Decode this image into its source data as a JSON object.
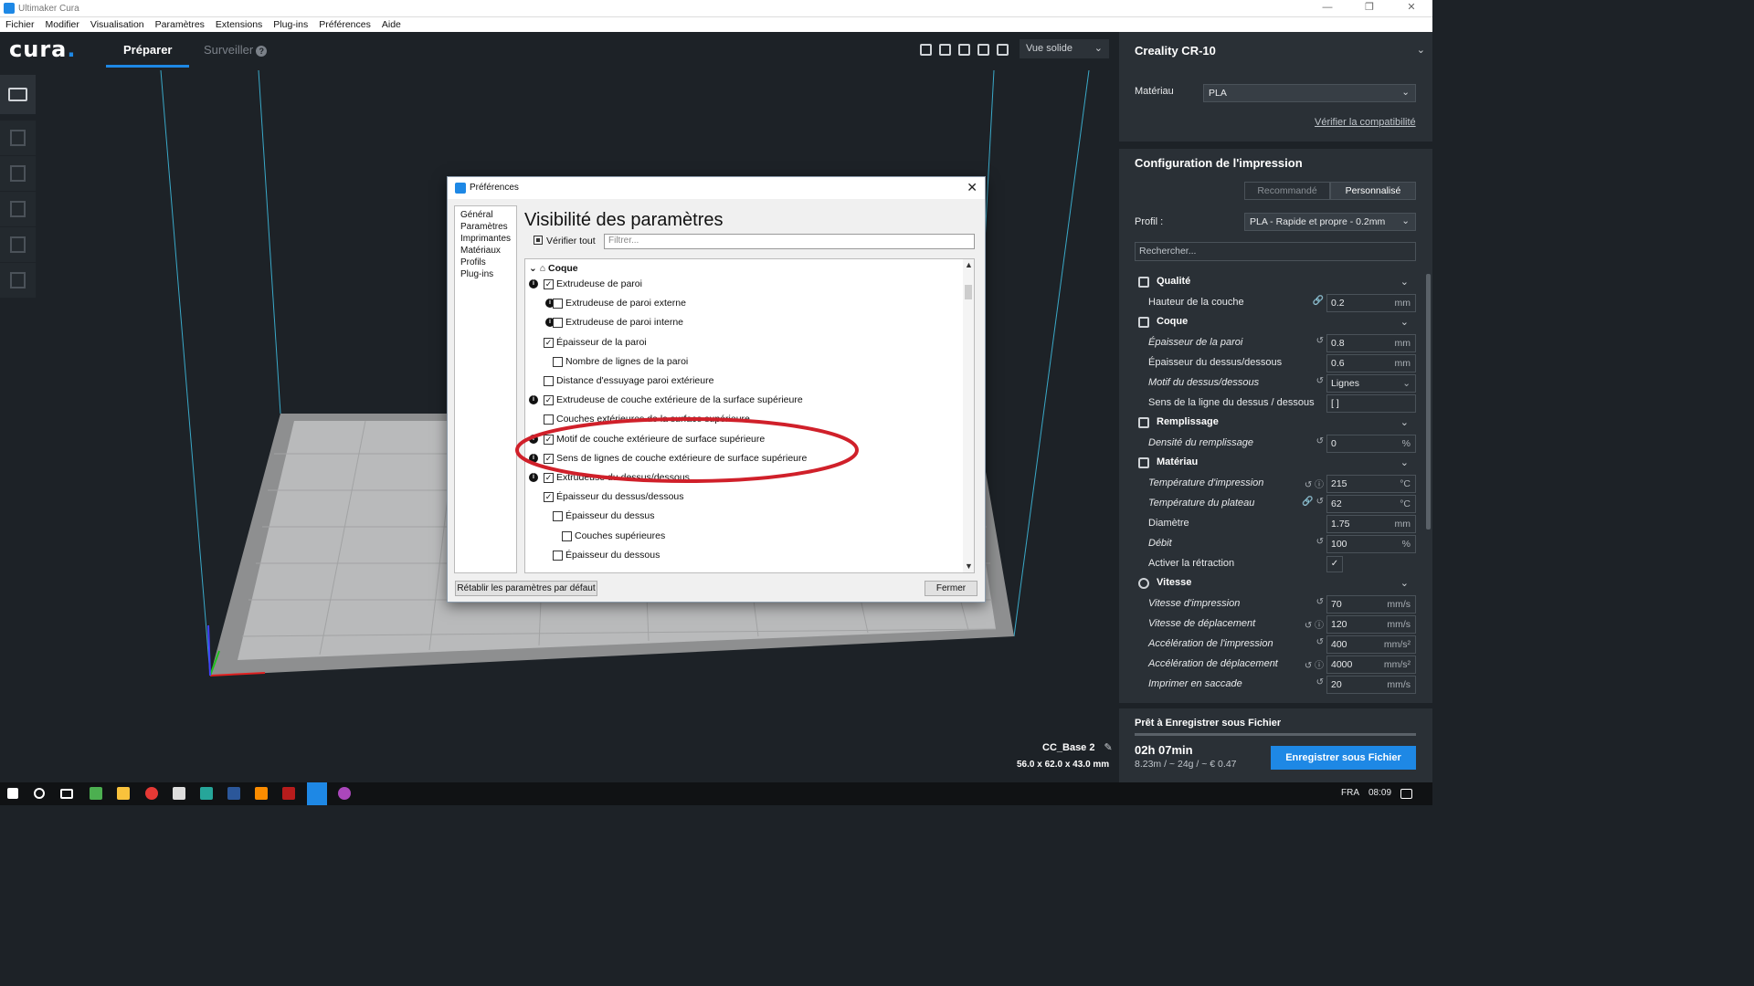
{
  "window": {
    "title": "Ultimaker Cura",
    "controls": [
      "—",
      "❐",
      "✕"
    ]
  },
  "menu": [
    "Fichier",
    "Modifier",
    "Visualisation",
    "Paramètres",
    "Extensions",
    "Plug-ins",
    "Préférences",
    "Aide"
  ],
  "header": {
    "logo": "cura",
    "logo_dot": ".",
    "tab_prepare": "Préparer",
    "tab_monitor": "Surveiller",
    "help_glyph": "?",
    "view_mode": "Vue solide"
  },
  "object": {
    "name": "CC_Base 2",
    "dimensions": "56.0 x 62.0 x 43.0 mm"
  },
  "sidebar": {
    "printer": "Creality CR-10",
    "material_label": "Matériau",
    "material_value": "PLA",
    "verify_link": "Vérifier la compatibilité",
    "config_title": "Configuration de l'impression",
    "mode_recommended": "Recommandé",
    "mode_custom": "Personnalisé",
    "profile_label": "Profil :",
    "profile_value": "PLA - Rapide et propre - 0.2mm",
    "search_placeholder": "Rechercher...",
    "categories": {
      "quality": "Qualité",
      "shell": "Coque",
      "infill": "Remplissage",
      "material": "Matériau",
      "speed": "Vitesse"
    },
    "settings": {
      "layer_height": {
        "label": "Hauteur de la couche",
        "value": "0.2",
        "unit": "mm"
      },
      "wall_thickness": {
        "label": "Épaisseur de la paroi",
        "value": "0.8",
        "unit": "mm"
      },
      "top_bottom_thickness": {
        "label": "Épaisseur du dessus/dessous",
        "value": "0.6",
        "unit": "mm"
      },
      "top_bottom_pattern": {
        "label": "Motif du dessus/dessous",
        "value": "Lignes"
      },
      "top_bottom_direction": {
        "label": "Sens de la ligne du dessus / dessous",
        "value": "[ ]"
      },
      "infill_density": {
        "label": "Densité du remplissage",
        "value": "0",
        "unit": "%"
      },
      "print_temp": {
        "label": "Température d'impression",
        "value": "215",
        "unit": "°C"
      },
      "bed_temp": {
        "label": "Température du plateau",
        "value": "62",
        "unit": "°C"
      },
      "diameter": {
        "label": "Diamètre",
        "value": "1.75",
        "unit": "mm"
      },
      "flow": {
        "label": "Débit",
        "value": "100",
        "unit": "%"
      },
      "retraction": {
        "label": "Activer la rétraction",
        "value": "✓"
      },
      "print_speed": {
        "label": "Vitesse d'impression",
        "value": "70",
        "unit": "mm/s"
      },
      "travel_speed": {
        "label": "Vitesse de déplacement",
        "value": "120",
        "unit": "mm/s"
      },
      "print_accel": {
        "label": "Accélération de l'impression",
        "value": "400",
        "unit": "mm/s²"
      },
      "travel_accel": {
        "label": "Accélération de déplacement",
        "value": "4000",
        "unit": "mm/s²"
      },
      "jerk": {
        "label": "Imprimer en saccade",
        "value": "20",
        "unit": "mm/s"
      }
    },
    "ready_title": "Prêt à Enregistrer sous Fichier",
    "print_time": "02h 07min",
    "estimate": "8.23m / ~ 24g / ~ € 0.47",
    "save_button": "Enregistrer sous Fichier"
  },
  "dialog": {
    "title": "Préférences",
    "close_glyph": "✕",
    "nav": [
      "Général",
      "Paramètres",
      "Imprimantes",
      "Matériaux",
      "Profils",
      "Plug-ins"
    ],
    "heading": "Visibilité des paramètres",
    "check_all": "Vérifier tout",
    "filter_placeholder": "Filtrer...",
    "section": "Coque",
    "items": [
      {
        "label": "Extrudeuse de paroi",
        "checked": true,
        "info": true,
        "indent": 0
      },
      {
        "label": "Extrudeuse de paroi externe",
        "checked": false,
        "info": true,
        "indent": 1
      },
      {
        "label": "Extrudeuse de paroi interne",
        "checked": false,
        "info": true,
        "indent": 1
      },
      {
        "label": "Épaisseur de la paroi",
        "checked": true,
        "info": false,
        "indent": 0
      },
      {
        "label": "Nombre de lignes de la paroi",
        "checked": false,
        "info": false,
        "indent": 1
      },
      {
        "label": "Distance d'essuyage paroi extérieure",
        "checked": false,
        "info": false,
        "indent": 0
      },
      {
        "label": "Extrudeuse de couche extérieure de la surface supérieure",
        "checked": true,
        "info": true,
        "indent": 0
      },
      {
        "label": "Couches extérieures de la surface supérieure",
        "checked": false,
        "info": false,
        "indent": 0
      },
      {
        "label": "Motif de couche extérieure de surface supérieure",
        "checked": true,
        "info": true,
        "indent": 0
      },
      {
        "label": "Sens de lignes de couche extérieure de surface supérieure",
        "checked": true,
        "info": true,
        "indent": 0
      },
      {
        "label": "Extrudeuse du dessus/dessous",
        "checked": true,
        "info": true,
        "indent": 0
      },
      {
        "label": "Épaisseur du dessus/dessous",
        "checked": true,
        "info": false,
        "indent": 0
      },
      {
        "label": "Épaisseur du dessus",
        "checked": false,
        "info": false,
        "indent": 1
      },
      {
        "label": "Couches supérieures",
        "checked": false,
        "info": false,
        "indent": 2
      },
      {
        "label": "Épaisseur du dessous",
        "checked": false,
        "info": false,
        "indent": 1
      }
    ],
    "reset_button": "Rétablir les paramètres par défaut",
    "close_button": "Fermer"
  },
  "taskbar": {
    "lang": "FRA",
    "time": "08:09"
  },
  "colors": {
    "accent": "#1e88e5",
    "background": "#1d2227",
    "sidebar": "#2a3036",
    "highlight_ellipse": "#d0202a"
  }
}
